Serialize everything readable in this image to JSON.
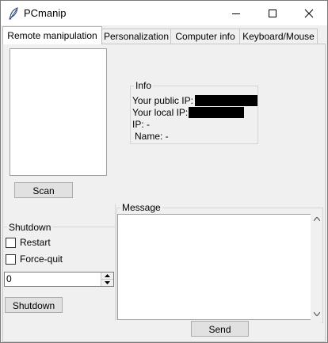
{
  "window": {
    "title": "PCmanip"
  },
  "tabs": [
    {
      "label": "Remote manipulation",
      "active": true
    },
    {
      "label": "Personalization",
      "active": false
    },
    {
      "label": "Computer info",
      "active": false
    },
    {
      "label": "Keyboard/Mouse",
      "active": false
    }
  ],
  "remote": {
    "scan_label": "Scan",
    "info": {
      "title": "Info",
      "public_ip_label": "Your public IP:",
      "local_ip_label": "Your local IP:",
      "ip_line": "IP: -",
      "name_line": "Name: -"
    }
  },
  "shutdown": {
    "title": "Shutdown",
    "restart_label": "Restart",
    "restart_checked": false,
    "force_quit_label": "Force-quit",
    "force_quit_checked": false,
    "delay_value": "0",
    "button_label": "Shutdown"
  },
  "message": {
    "title": "Message",
    "value": "",
    "send_label": "Send"
  },
  "colors": {
    "window_bg": "#f0f0f0",
    "titlebar_bg": "#ffffff",
    "button_bg": "#e1e1e1",
    "redaction": "#000000"
  },
  "icons": {
    "app": "feather-icon",
    "minimize": "minimize-icon",
    "maximize": "maximize-icon",
    "close": "close-icon",
    "spin_up": "spin-up-icon",
    "spin_down": "spin-down-icon",
    "scroll_up": "scroll-up-arrow-icon",
    "scroll_down": "scroll-down-arrow-icon"
  }
}
